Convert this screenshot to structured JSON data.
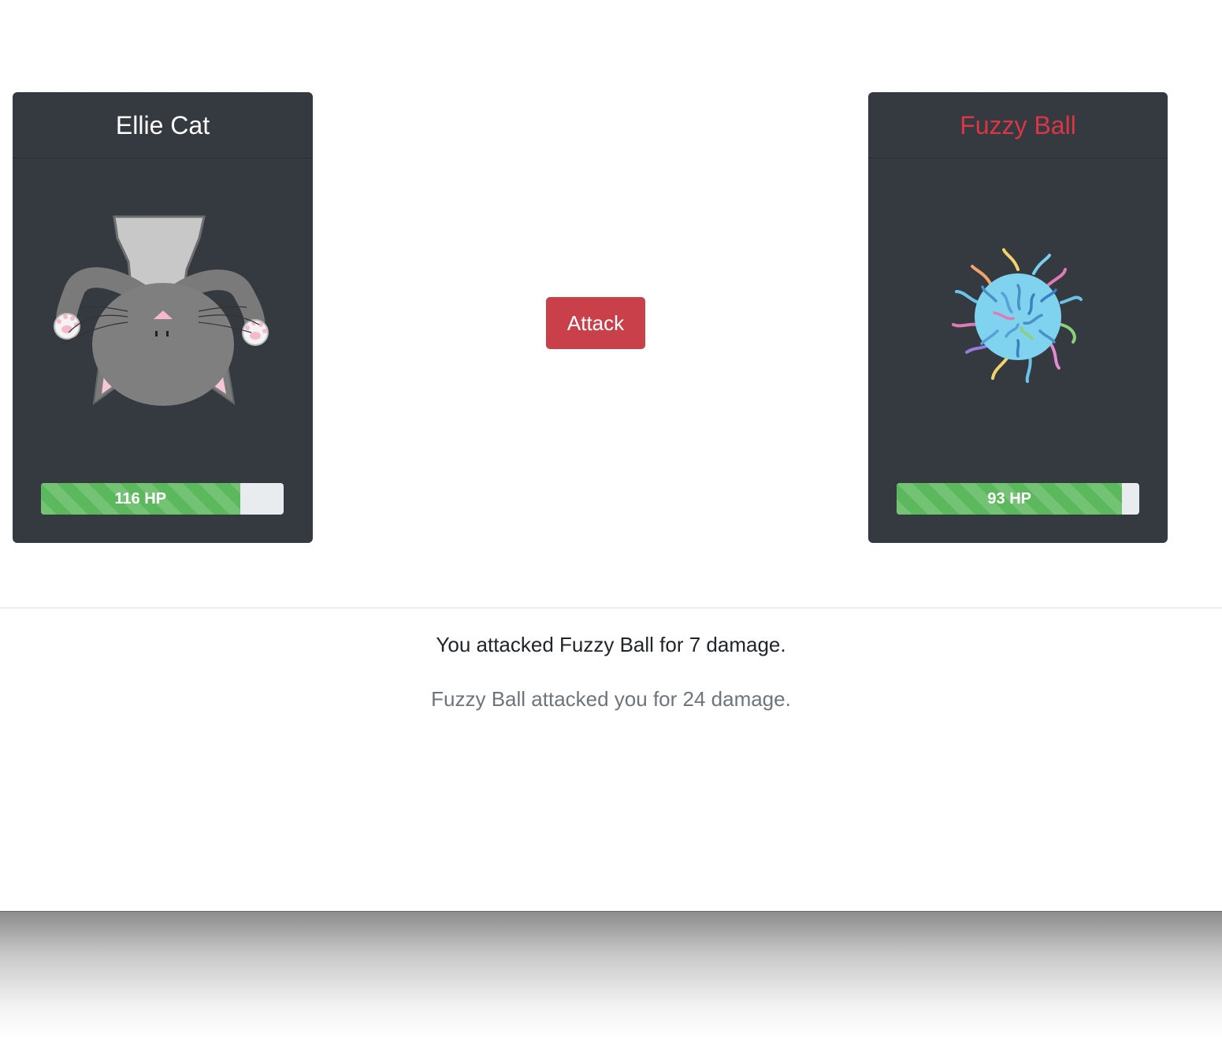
{
  "player": {
    "name": "Ellie Cat",
    "hp_label": "116 HP",
    "hp_fraction": 0.82,
    "art_icon": "upside-down-cat-icon"
  },
  "enemy": {
    "name": "Fuzzy Ball",
    "hp_label": "93 HP",
    "hp_fraction": 0.93,
    "art_icon": "fuzzy-ball-icon"
  },
  "controls": {
    "attack_label": "Attack"
  },
  "log": {
    "player_message": "You attacked Fuzzy Ball for 7 damage.",
    "enemy_message": "Fuzzy Ball attacked you for 24 damage."
  },
  "colors": {
    "card_bg": "#343a40",
    "enemy_name": "#dc3545",
    "attack_button": "#c9404a",
    "hp_fill": "#5cb85c",
    "hp_track": "#e9ecef"
  }
}
